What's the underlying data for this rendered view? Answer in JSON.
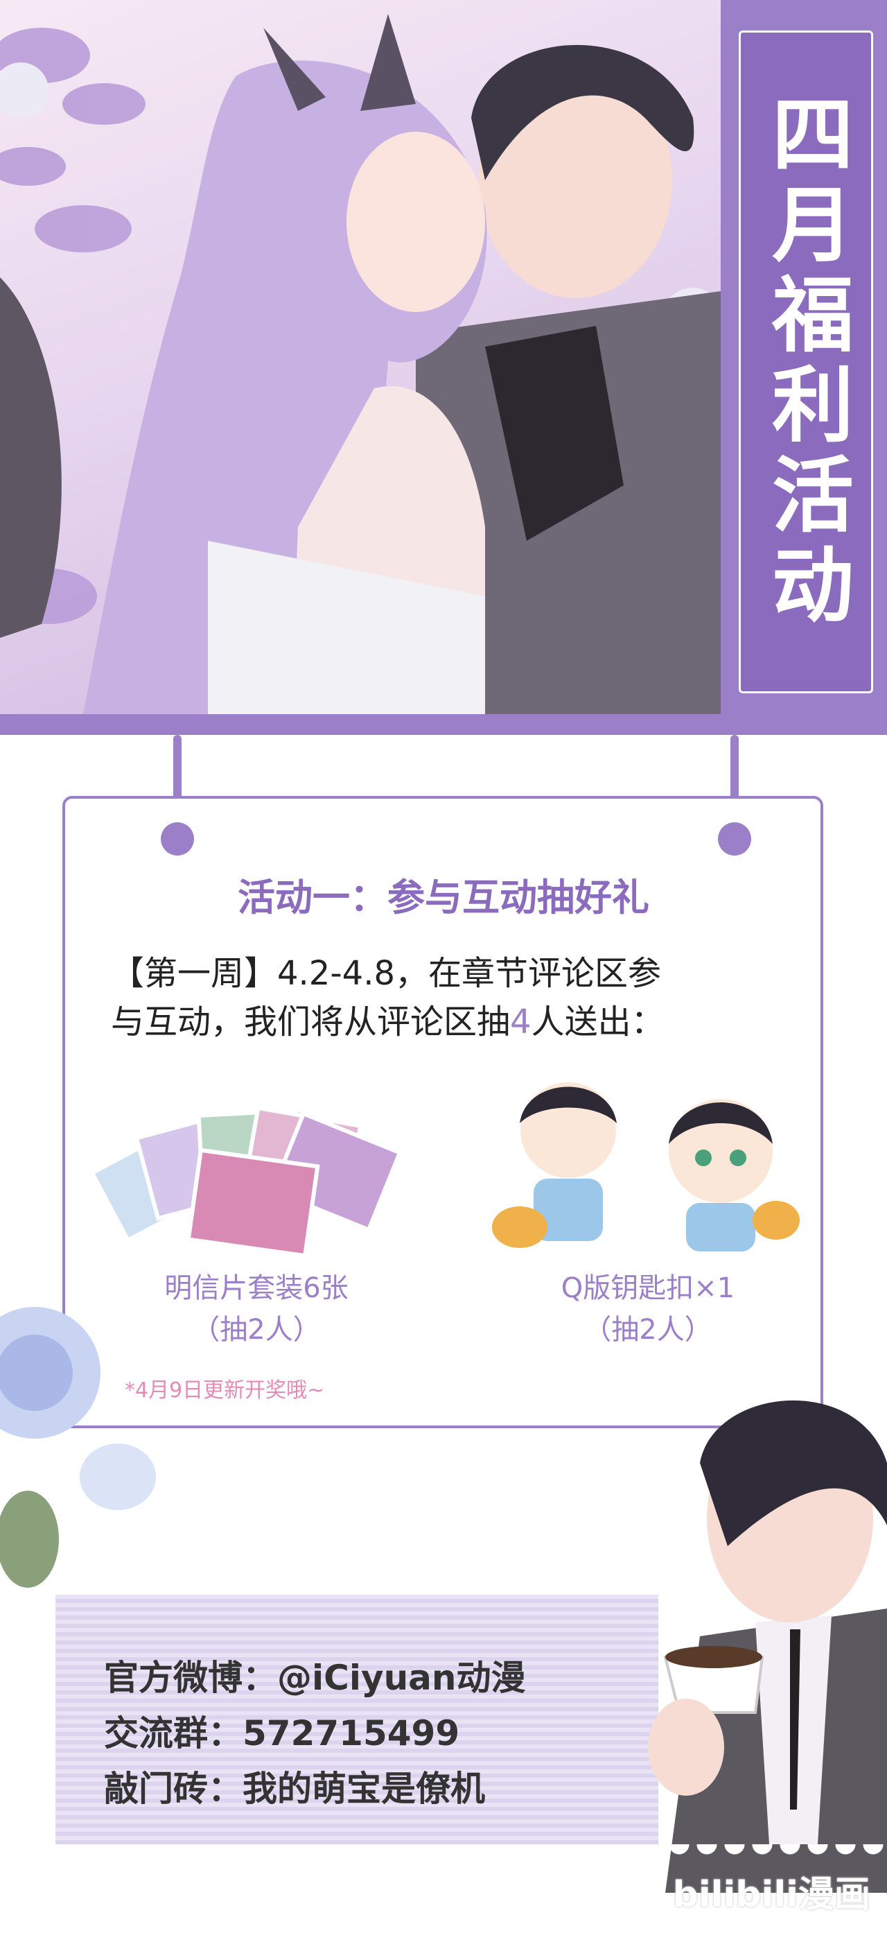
{
  "banner": {
    "title": "四月福利活动"
  },
  "activity": {
    "title": "活动一：参与互动抽好礼",
    "line1_prefix": "【第一周】4.2-4.8，在章节评论区参",
    "line2_prefix": "与互动，我们将从评论区抽",
    "line2_highlight": "4",
    "line2_suffix": "人送出："
  },
  "prizes": [
    {
      "name": "明信片套装6张",
      "draw": "（抽2人）"
    },
    {
      "name": "Q版钥匙扣×1",
      "draw": "（抽2人）"
    }
  ],
  "note": "*4月9日更新开奖哦~",
  "footer": {
    "weibo": "官方微博：@iCiyuan动漫",
    "group": "交流群：572715499",
    "door": "敲门砖：我的萌宝是僚机"
  },
  "watermark": "bilibili漫画",
  "colors": {
    "accent": "#9b7fc9",
    "accent_dark": "#8a6bbd",
    "note_pink": "#e48ab6"
  }
}
